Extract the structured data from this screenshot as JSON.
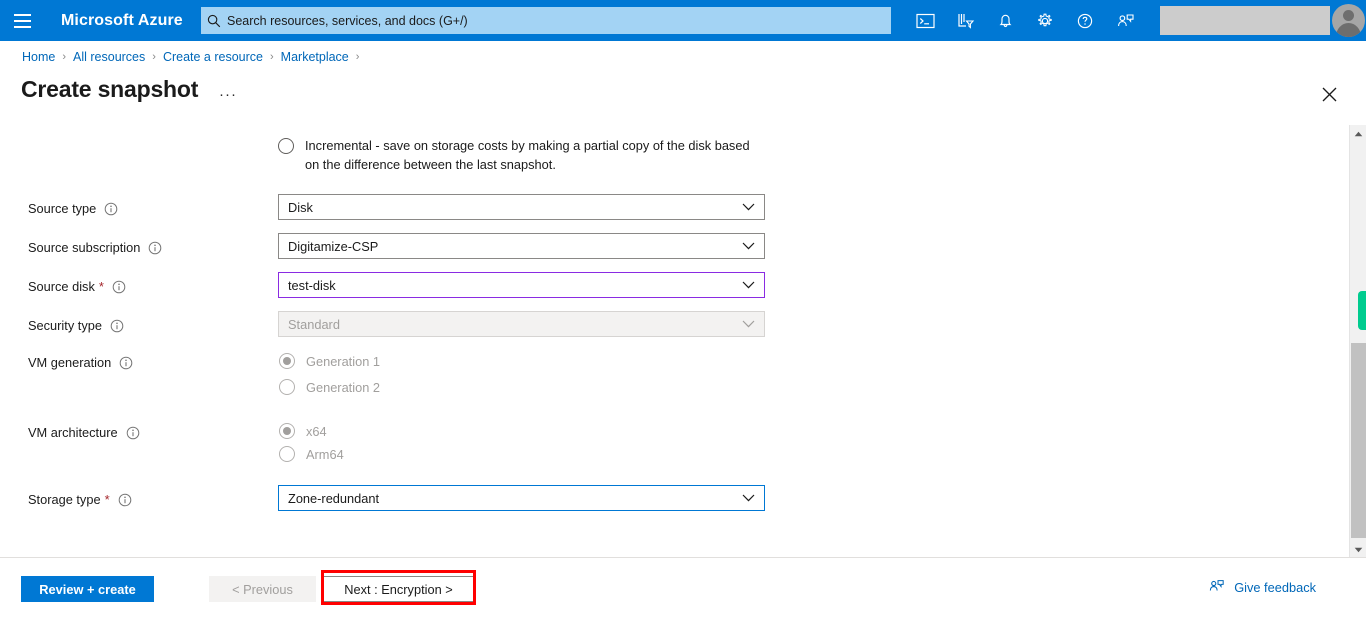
{
  "header": {
    "menu_icon": "hamburger-icon",
    "brand": "Microsoft Azure",
    "search_placeholder": "Search resources, services, and docs (G+/)",
    "search_value": "",
    "icons": [
      {
        "name": "cloud-shell-icon",
        "title": "Cloud Shell"
      },
      {
        "name": "directory-filter-icon",
        "title": "Directories + subscriptions"
      },
      {
        "name": "notifications-bell-icon",
        "title": "Notifications"
      },
      {
        "name": "settings-gear-icon",
        "title": "Settings"
      },
      {
        "name": "help-question-icon",
        "title": "Help"
      },
      {
        "name": "feedback-person-icon",
        "title": "Feedback"
      }
    ],
    "account_box_masked": "",
    "avatar": "user-avatar"
  },
  "breadcrumb": {
    "items": [
      "Home",
      "All resources",
      "Create a resource",
      "Marketplace"
    ],
    "separator": "›"
  },
  "page": {
    "title": "Create snapshot",
    "more_menu": "···",
    "close_label": "Close"
  },
  "form": {
    "incremental": {
      "label": "Incremental - save on storage costs by making a partial copy of the disk based on the difference between the last snapshot.",
      "checked": false
    },
    "fields": [
      {
        "label": "Source type",
        "required": false,
        "info": true,
        "value": "Disk",
        "state": "normal"
      },
      {
        "label": "Source subscription",
        "required": false,
        "info": true,
        "value": "Digitamize-CSP",
        "state": "normal"
      },
      {
        "label": "Source disk",
        "required": true,
        "info": true,
        "value": "test-disk",
        "state": "visited"
      },
      {
        "label": "Security type",
        "required": false,
        "info": true,
        "value": "Standard",
        "state": "disabled"
      }
    ],
    "vm_generation": {
      "label": "VM generation",
      "info": true,
      "options": [
        {
          "label": "Generation 1",
          "checked": true
        },
        {
          "label": "Generation 2",
          "checked": false
        }
      ],
      "disabled": true
    },
    "vm_architecture": {
      "label": "VM architecture",
      "info": true,
      "options": [
        {
          "label": "x64",
          "checked": true
        },
        {
          "label": "Arm64",
          "checked": false
        }
      ],
      "disabled": true
    },
    "storage_type": {
      "label": "Storage type",
      "required": true,
      "info": true,
      "value": "Zone-redundant",
      "state": "focused"
    }
  },
  "footer": {
    "review_create": "Review + create",
    "previous": "< Previous",
    "next": "Next : Encryption >",
    "give_feedback": "Give feedback"
  },
  "scrollbar": {
    "up_arrow": "scroll-up-arrow",
    "down_arrow": "scroll-down-arrow",
    "marker_color": "#00cc8f"
  },
  "colors": {
    "azure_blue": "#0078d4",
    "link_blue": "#0067b8",
    "required_red": "#a4262c",
    "visited_purple": "#8a2be2",
    "highlight_red": "#ff0000",
    "marker_green": "#00cc8f"
  }
}
